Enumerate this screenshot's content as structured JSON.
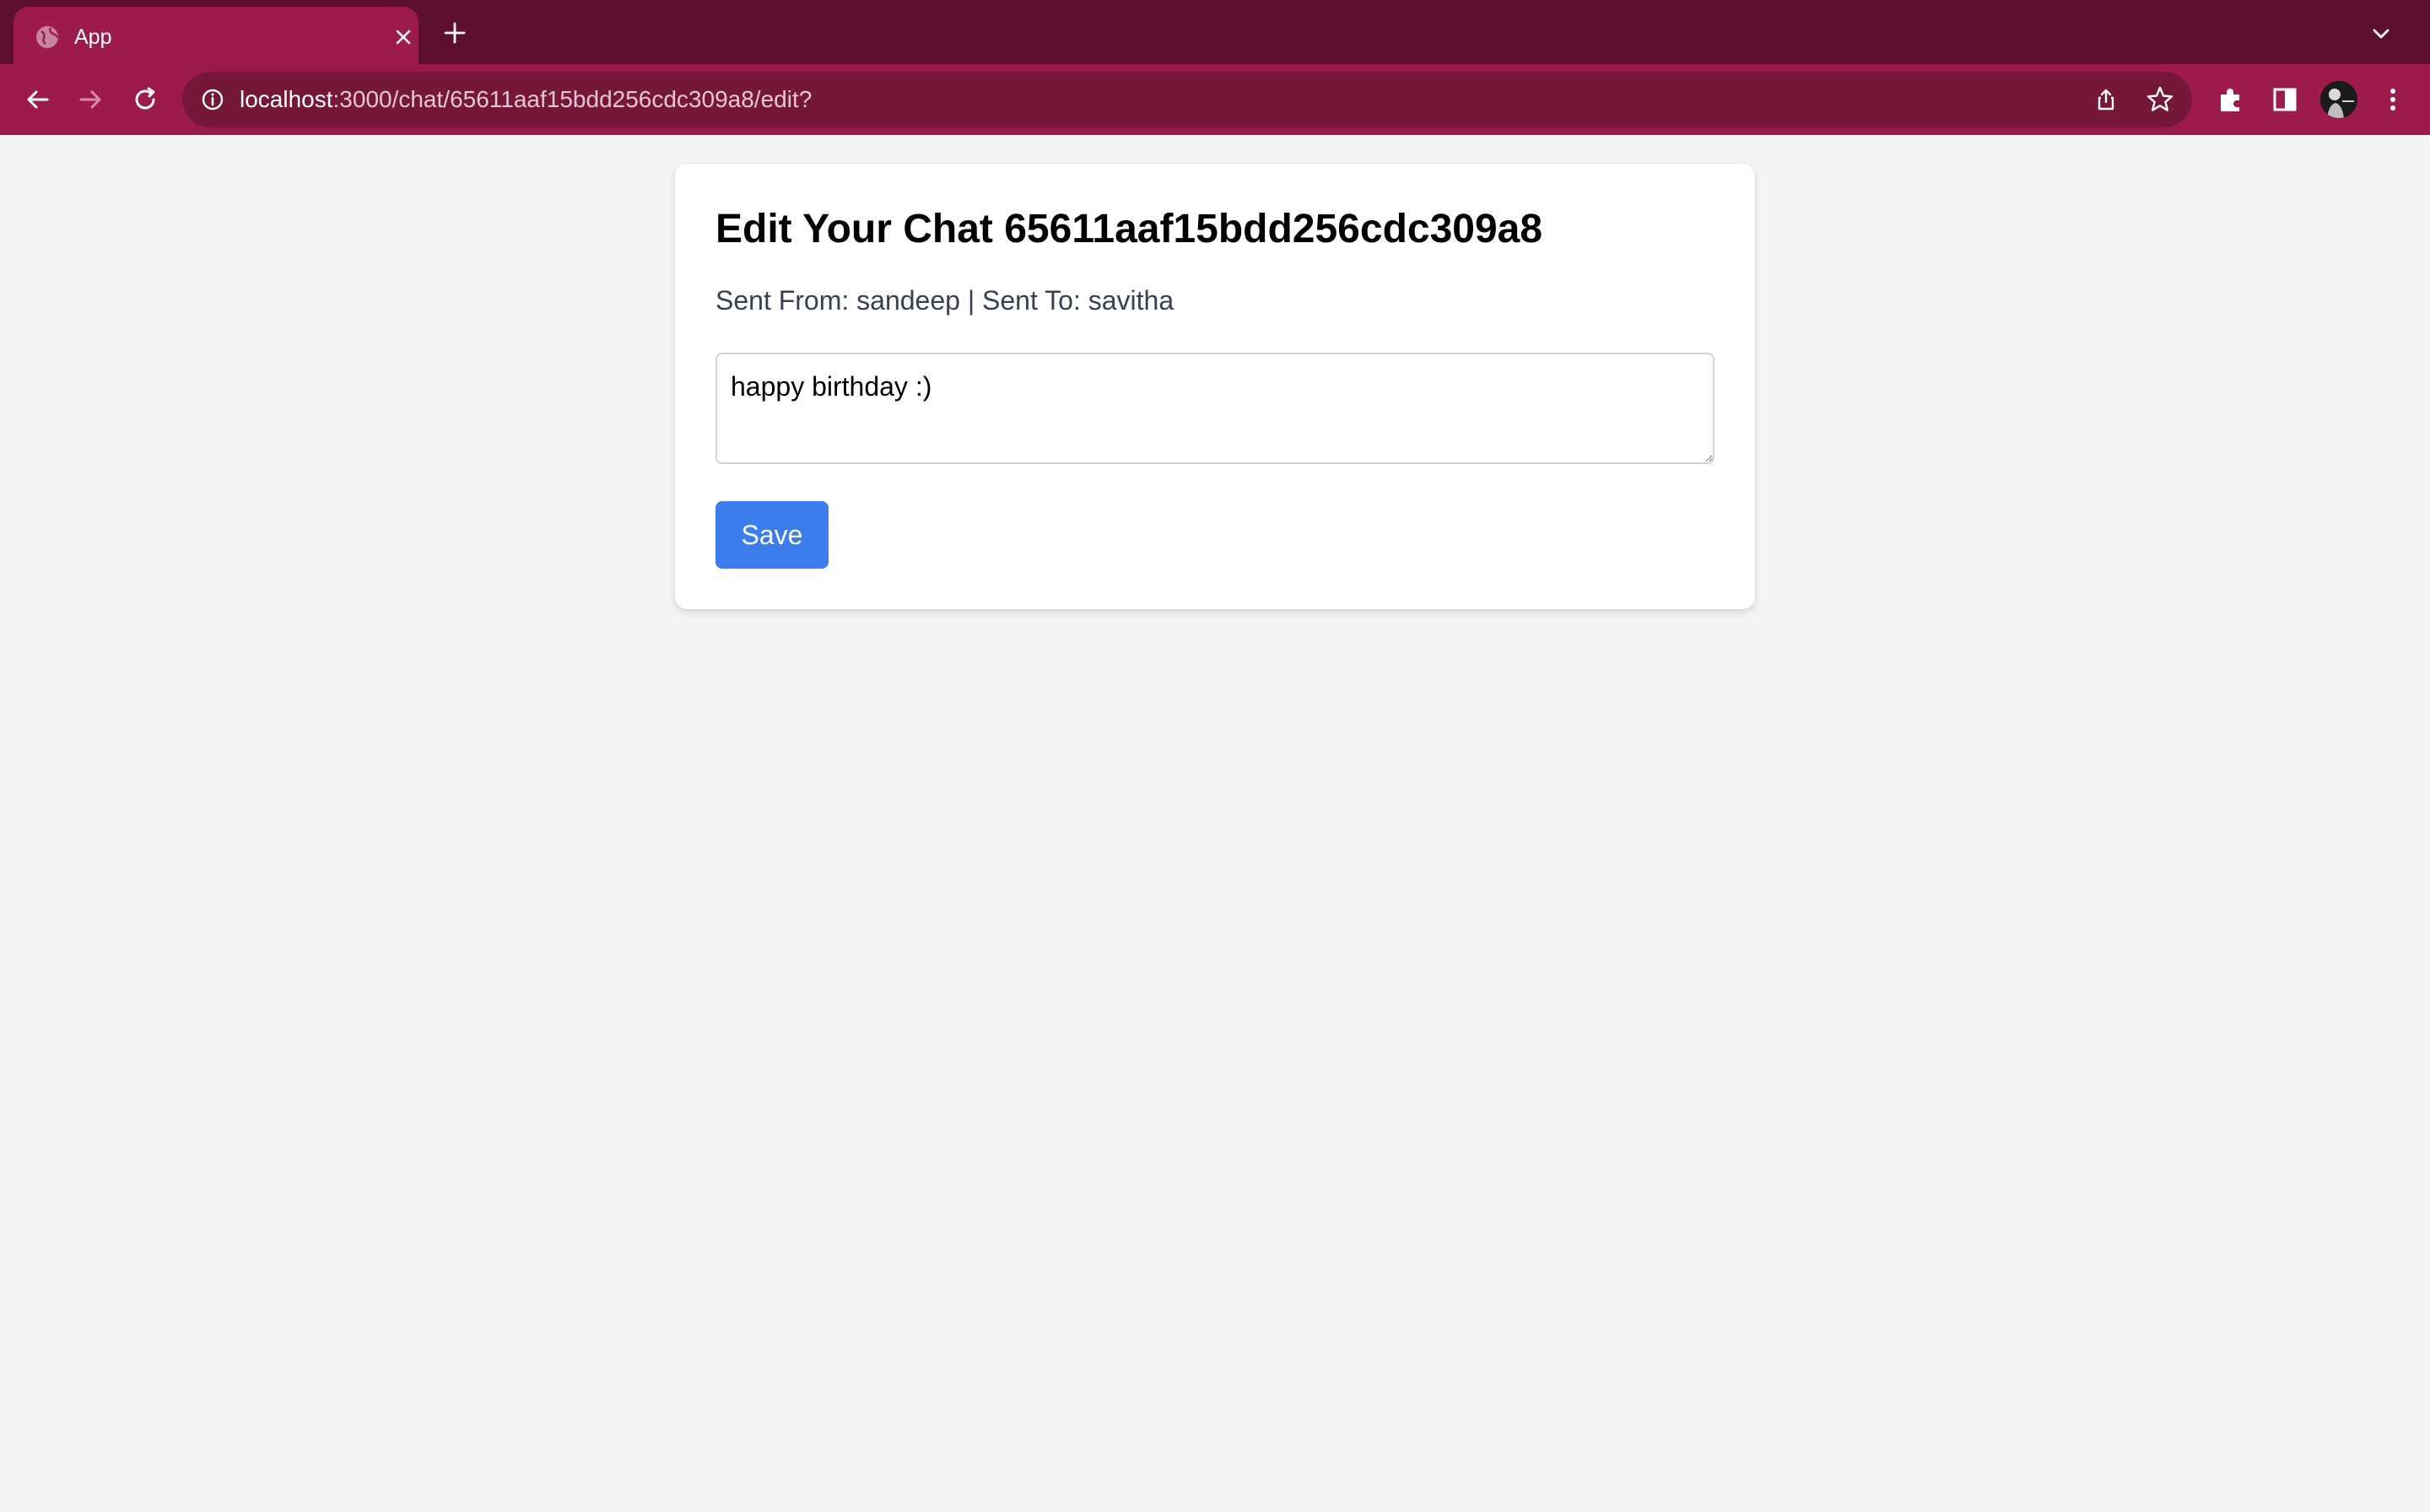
{
  "browser": {
    "tab": {
      "title": "App"
    },
    "address_bar": {
      "host": "localhost",
      "path": ":3000/chat/65611aaf15bdd256cdc309a8/edit?"
    }
  },
  "page": {
    "title": "Edit Your Chat 65611aaf15bdd256cdc309a8",
    "meta": "Sent From: sandeep | Sent To: savitha",
    "message_value": "happy birthday :)",
    "save_label": "Save"
  },
  "colors": {
    "tabstrip": "#5e0f2e",
    "toolbar": "#9c1a4c",
    "omnibox": "#741739",
    "page_bg": "#f3f4f6",
    "save_button": "#3b7ded"
  }
}
